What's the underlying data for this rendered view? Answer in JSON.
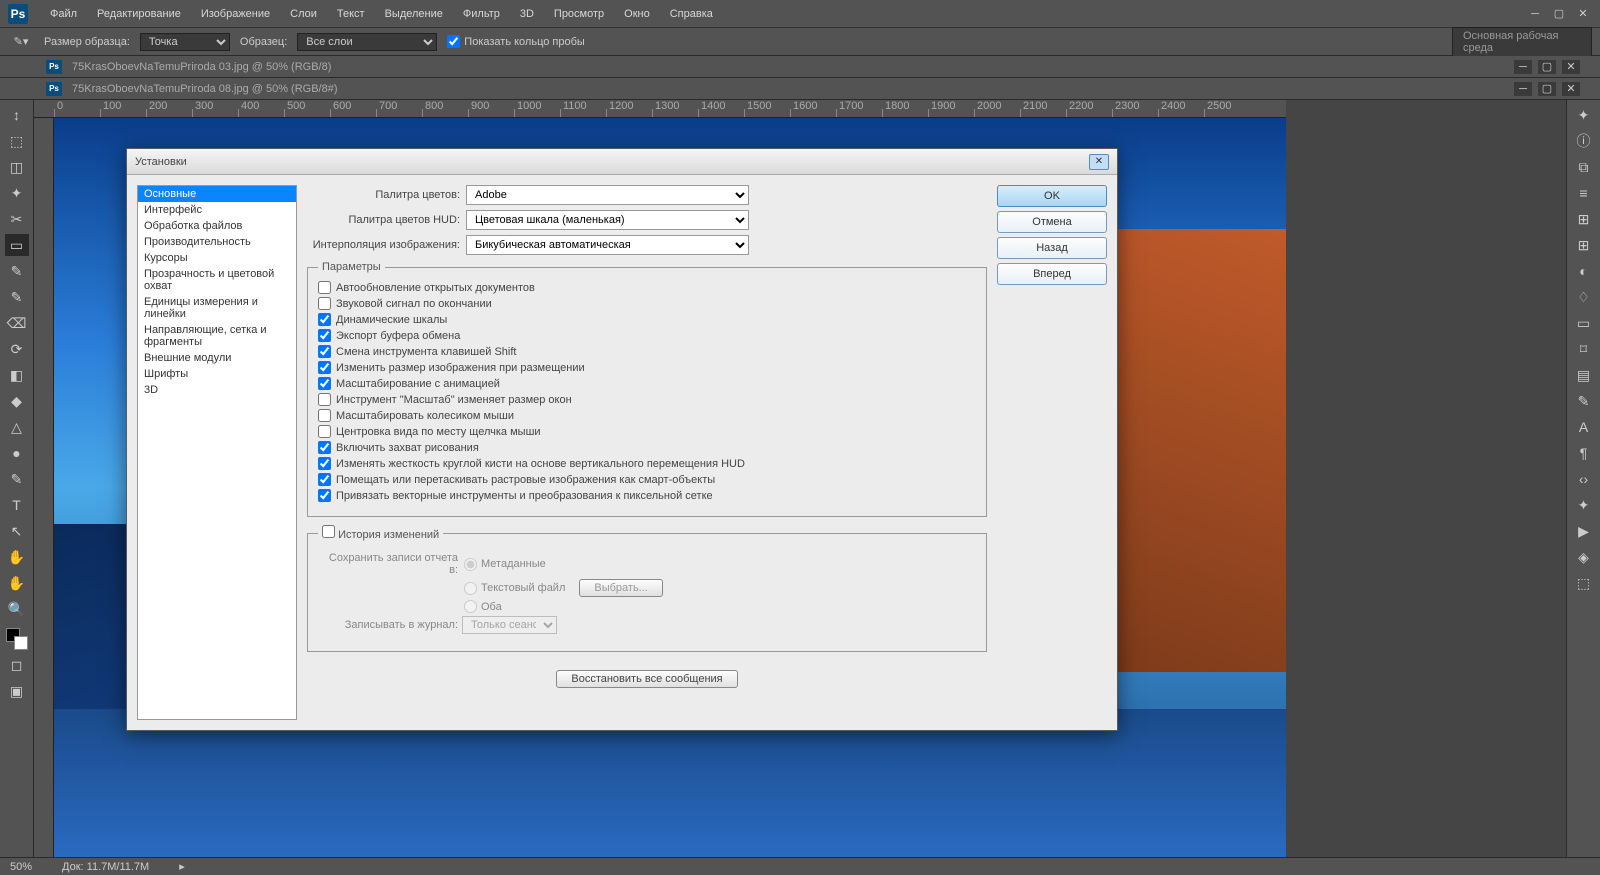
{
  "app": {
    "logo": "Ps"
  },
  "menu": [
    "Файл",
    "Редактирование",
    "Изображение",
    "Слои",
    "Текст",
    "Выделение",
    "Фильтр",
    "3D",
    "Просмотр",
    "Окно",
    "Справка"
  ],
  "options": {
    "size_label": "Размер образца:",
    "size_value": "Точка",
    "sample_label": "Образец:",
    "sample_value": "Все слои",
    "ring_label": "Показать кольцо пробы",
    "workspace": "Основная рабочая среда"
  },
  "tabs": [
    "75KrasOboevNaTemuPriroda 03.jpg @ 50% (RGB/8)",
    "75KrasOboevNaTemuPriroda 08.jpg @ 50% (RGB/8#)"
  ],
  "ruler_ticks": [
    "0",
    "100",
    "200",
    "300",
    "400",
    "500",
    "600",
    "700",
    "800",
    "900",
    "1000",
    "1100",
    "1200",
    "1300",
    "1400",
    "1500",
    "1600",
    "1700",
    "1800",
    "1900",
    "2000",
    "2100",
    "2200",
    "2300",
    "2400",
    "2500"
  ],
  "status": {
    "zoom": "50%",
    "doc": "Док: 11.7M/11.7M"
  },
  "dialog": {
    "title": "Установки",
    "categories": [
      "Основные",
      "Интерфейс",
      "Обработка файлов",
      "Производительность",
      "Курсоры",
      "Прозрачность и цветовой охват",
      "Единицы измерения и линейки",
      "Направляющие, сетка и фрагменты",
      "Внешние модули",
      "Шрифты",
      "3D"
    ],
    "sel_cat": 0,
    "color_picker_label": "Палитра цветов:",
    "color_picker_value": "Adobe",
    "hud_label": "Палитра цветов HUD:",
    "hud_value": "Цветовая шкала (маленькая)",
    "interp_label": "Интерполяция изображения:",
    "interp_value": "Бикубическая автоматическая",
    "params_legend": "Параметры",
    "checks": [
      {
        "c": false,
        "t": "Автообновление открытых документов"
      },
      {
        "c": false,
        "t": "Звуковой сигнал по окончании"
      },
      {
        "c": true,
        "t": "Динамические шкалы"
      },
      {
        "c": true,
        "t": "Экспорт буфера обмена"
      },
      {
        "c": true,
        "t": "Смена инструмента клавишей Shift"
      },
      {
        "c": true,
        "t": "Изменить размер изображения при размещении"
      },
      {
        "c": true,
        "t": "Масштабирование с анимацией"
      },
      {
        "c": false,
        "t": "Инструмент \"Масштаб\" изменяет размер окон"
      },
      {
        "c": false,
        "t": "Масштабировать колесиком мыши"
      },
      {
        "c": false,
        "t": "Центровка вида по месту щелчка мыши"
      },
      {
        "c": true,
        "t": "Включить захват рисования"
      },
      {
        "c": true,
        "t": "Изменять жесткость круглой кисти на основе вертикального перемещения HUD"
      },
      {
        "c": true,
        "t": "Помещать или перетаскивать растровые изображения как смарт-объекты"
      },
      {
        "c": true,
        "t": "Привязать векторные инструменты и преобразования к пиксельной сетке"
      }
    ],
    "history_legend": "История изменений",
    "history_checked": false,
    "save_log_label": "Сохранить записи отчета в:",
    "radio_meta": "Метаданные",
    "radio_text": "Текстовый файл",
    "radio_both": "Оба",
    "choose_btn": "Выбрать...",
    "log_items_label": "Записывать в журнал:",
    "log_items_value": "Только сеансы",
    "restore": "Восстановить все сообщения",
    "buttons": {
      "ok": "OK",
      "cancel": "Отмена",
      "prev": "Назад",
      "next": "Вперед"
    }
  },
  "tool_icons": [
    "↕",
    "⬚",
    "◫",
    "✦",
    "✂",
    "▭",
    "✎",
    "✎",
    "⌫",
    "⟳",
    "◧",
    "◆",
    "△",
    "●",
    "✎",
    "T",
    "↖",
    "✋",
    "✋",
    "🔍"
  ],
  "right_icons": [
    "✦",
    "ⓘ",
    "⧉",
    "≡",
    "⊞",
    "⊞",
    "◐",
    "♢",
    "▭",
    "⌑",
    "▤",
    "✎",
    "A",
    "¶",
    "‹›",
    "✦",
    "▶",
    "◈",
    "⬚"
  ]
}
